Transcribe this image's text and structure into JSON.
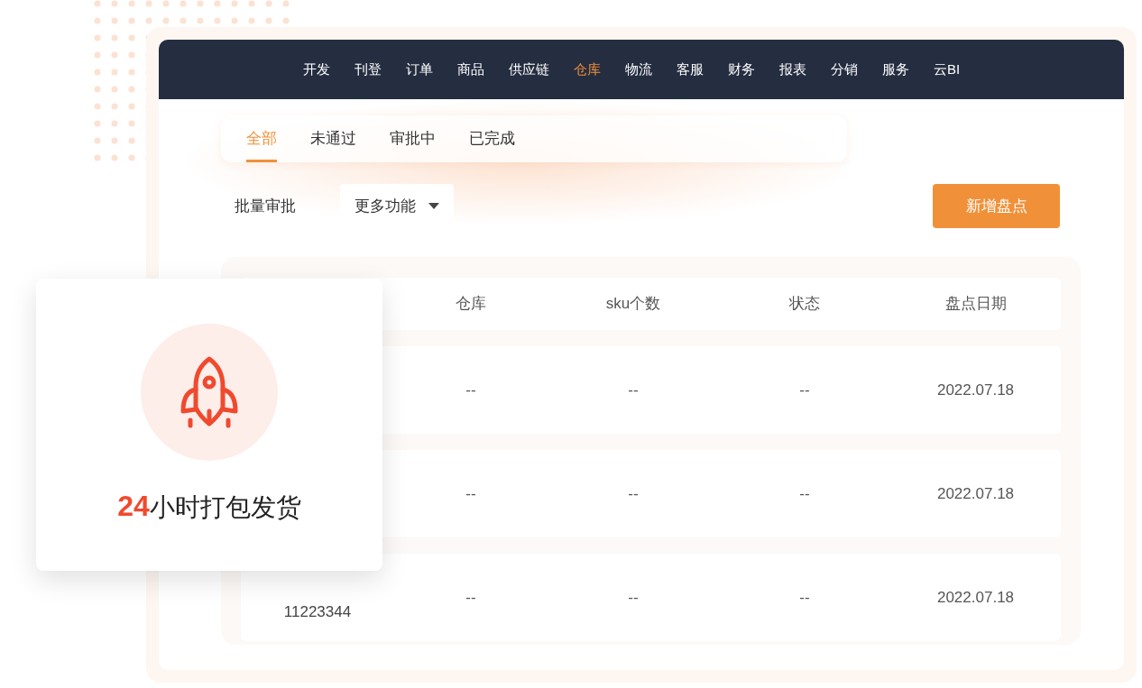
{
  "nav": {
    "items": [
      {
        "label": "开发",
        "selected": false
      },
      {
        "label": "刊登",
        "selected": false
      },
      {
        "label": "订单",
        "selected": false
      },
      {
        "label": "商品",
        "selected": false
      },
      {
        "label": "供应链",
        "selected": false
      },
      {
        "label": "仓库",
        "selected": true
      },
      {
        "label": "物流",
        "selected": false
      },
      {
        "label": "客服",
        "selected": false
      },
      {
        "label": "财务",
        "selected": false
      },
      {
        "label": "报表",
        "selected": false
      },
      {
        "label": "分销",
        "selected": false
      },
      {
        "label": "服务",
        "selected": false
      },
      {
        "label": "云BI",
        "selected": false
      }
    ]
  },
  "tabs": [
    {
      "label": "全部",
      "selected": true
    },
    {
      "label": "未通过",
      "selected": false
    },
    {
      "label": "审批中",
      "selected": false
    },
    {
      "label": "已完成",
      "selected": false
    }
  ],
  "toolbar": {
    "batch_approve": "批量审批",
    "more_dropdown": "更多功能",
    "add_button": "新增盘点"
  },
  "table": {
    "columns": [
      "仓库",
      "sku个数",
      "状态",
      "盘点日期"
    ],
    "rows": [
      {
        "cells": [
          "--",
          "--",
          "--",
          "2022.07.18"
        ]
      },
      {
        "cells": [
          "--",
          "--",
          "--",
          "2022.07.18"
        ]
      },
      {
        "column_1": "11223344",
        "cells": [
          "--",
          "--",
          "--",
          "2022.07.18"
        ]
      }
    ]
  },
  "feature_card": {
    "highlight": "24",
    "text": "小时打包发货"
  }
}
